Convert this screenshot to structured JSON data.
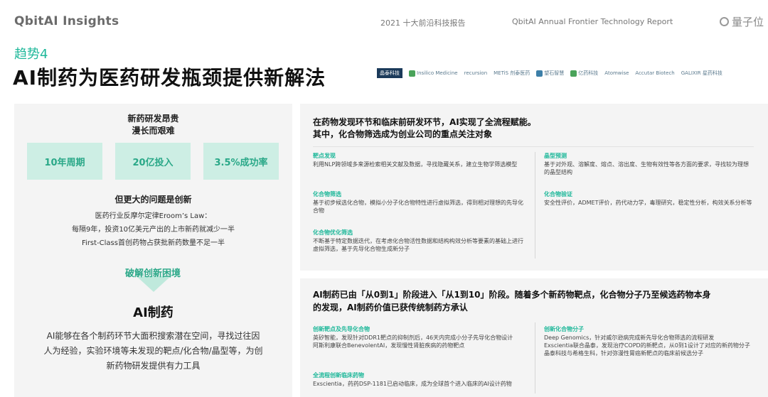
{
  "header": {
    "brand": "QbitAI Insights",
    "report_cn": "2021 十大前沿科技报告",
    "report_en": "QbitAI  Annual Frontier Technology Report",
    "logo": "量子位"
  },
  "trend_label": "趋势4",
  "title": "AI制药为医药研发瓶颈提供新解法",
  "partners": [
    "晶泰科技",
    "Insilico Medicine",
    "recursion",
    "METiS 剂泰医药",
    "望石智慧",
    "亿药科技",
    "Atomwise",
    "Accutar Biotech",
    "GALIXIR 星药科技"
  ],
  "left": {
    "h1": "新药研发昂贵",
    "h2": "漫长而艰难",
    "stats": [
      "10年周期",
      "20亿投入",
      "3.5%成功率"
    ],
    "problem": "但更大的问题是创新",
    "eroom_lines": [
      "医药行业反摩尔定律Eroom’s Law：",
      "每隔9年，投资10亿美元产出的上市新药就减少一半",
      "First-Class首创药物占获批新药数量不足一半"
    ],
    "breakthrough": "破解创新困境",
    "ai_title": "AI制药",
    "ai_desc": "AI能够在各个制药环节大面积搜索潜在空间，寻找过往因人为经验，实验环境等未发现的靶点/化合物/晶型等，为创新药物研发提供有力工具"
  },
  "right_top": {
    "head_line1": "在药物发现环节和临床前研发环节，AI实现了全流程赋能。",
    "head_line2": "其中，化合物筛选成为创业公司的重点关注对象",
    "items": [
      {
        "title": "靶点发现",
        "text": "利用NLP跨领域多来源检索相关文献及数据，寻找隐藏关系，建立生物学筛选模型"
      },
      {
        "title": "化合物筛选",
        "text": "基于初步候选化合物，模拟小分子化合物特性进行虚拟筛选，得到相对理想的先导化合物"
      },
      {
        "title": "化合物优化筛选",
        "text": "不断基于特定数据迭代，在考虑化合物活性数据和结构构效分析等要素的基础上进行虚拟筛选，基于先导化合物生成新分子"
      },
      {
        "title": "晶型预测",
        "text": "基于对外观、溶解度、熔点、溶出度、生物有效性等各方面的要求，寻找较为理想的晶型结构"
      },
      {
        "title": "化合物验证",
        "text": "安全性评价，ADMET评价，药代动力学，毒理研究，稳定性分析，构效关系分析等"
      }
    ]
  },
  "right_bottom": {
    "head_line1": "AI制药已由「从0到1」阶段进入「从1到10」阶段。随着多个新药物靶点，化合物分子乃至候选药物本身",
    "head_line2": "的发现，AI制药价值已获传统制药方承认",
    "items": [
      {
        "title": "创新靶点及先导化合物",
        "text": "英矽智能，发现针对DDR1靶点的抑制剂后，46天内完成小分子先导化合物设计",
        "text2": "阿斯利康联合BenevolentAI，发现慢性肾脏疾病的药物靶点"
      },
      {
        "title": "全流程创新临床药物",
        "text": "Exscientia，药药DSP-1181已启动临床，成为全球首个进入临床的AI设计药物",
        "text2": ""
      },
      {
        "title": "创新化合物分子",
        "text": "Deep Genomics，针对威尔逊病完成新先导化合物筛选的流程研发",
        "text2": "Exscientia联合晶泰，发现治疗COPD的新靶点，从0到1设计了对应的新药物分子晶泰科技与希格生科，针对弥漫性胃癌新靶点的临床前候选分子"
      }
    ]
  },
  "colors": {
    "accent": "#1fb89a",
    "stat_bg": "#cdeee4",
    "panel_bg": "#f4f4f4"
  }
}
